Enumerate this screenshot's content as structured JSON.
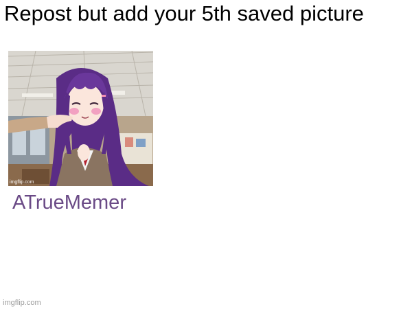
{
  "meme": {
    "title": "Repost but add your 5th saved picture",
    "caption": "ATrueMemer",
    "picture_watermark": "imgflip.com",
    "watermark": "imgflip.com",
    "caption_color": "#6a4a86"
  }
}
